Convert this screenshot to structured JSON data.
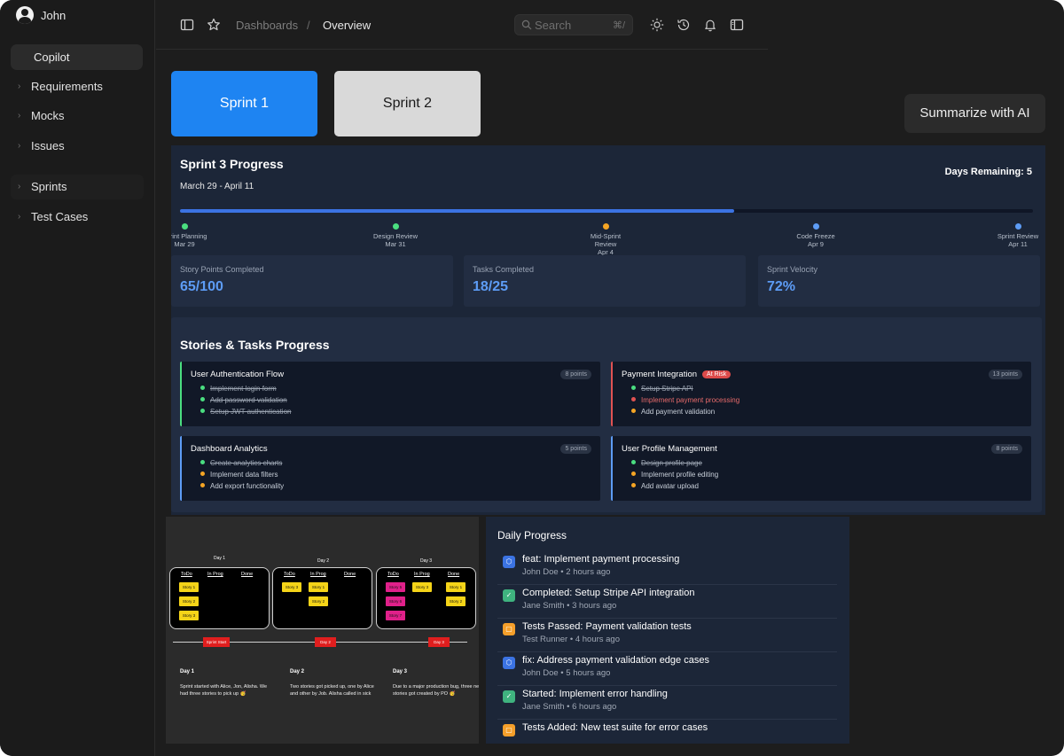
{
  "user": {
    "name": "John"
  },
  "sidebar": {
    "copilot_label": "Copilot",
    "items": [
      {
        "label": "Requirements"
      },
      {
        "label": "Mocks"
      },
      {
        "label": "Issues"
      },
      {
        "label": "Sprints"
      },
      {
        "label": "Test Cases"
      }
    ]
  },
  "topbar": {
    "breadcrumb_parent": "Dashboards",
    "breadcrumb_separator": "/",
    "breadcrumb_current": "Overview",
    "search_placeholder": "Search",
    "search_shortcut": "⌘/",
    "icons": [
      "sidebar-toggle-icon",
      "star-icon",
      "sun-icon",
      "history-icon",
      "bell-icon",
      "panel-icon"
    ]
  },
  "sprint_tabs": {
    "sprint1": "Sprint 1",
    "sprint2": "Sprint 2"
  },
  "summarize_label": "Summarize with AI",
  "progress": {
    "title": "Sprint 3 Progress",
    "dates": "March 29 - April 11",
    "days_remaining": "Days Remaining: 5",
    "fill_fraction": 0.65,
    "milestones": [
      {
        "name": "Sprint Planning",
        "date": "Mar 29",
        "color": "#4ade80"
      },
      {
        "name": "Design Review",
        "date": "Mar 31",
        "color": "#4ade80"
      },
      {
        "name": "Mid-Sprint Review",
        "date": "Apr 4",
        "color": "#f5a524"
      },
      {
        "name": "Code Freeze",
        "date": "Apr 9",
        "color": "#5d9cf5"
      },
      {
        "name": "Sprint Review",
        "date": "Apr 11",
        "color": "#5d9cf5"
      }
    ],
    "stats": [
      {
        "label": "Story Points Completed",
        "value": "65/100"
      },
      {
        "label": "Tasks Completed",
        "value": "18/25"
      },
      {
        "label": "Sprint Velocity",
        "value": "72%"
      }
    ]
  },
  "stories": {
    "title": "Stories & Tasks Progress",
    "cards": [
      {
        "title": "User Authentication Flow",
        "points": "8 points",
        "badge": "",
        "accent": "#4ade80",
        "tasks": [
          {
            "text": "Implement login form",
            "state": "done"
          },
          {
            "text": "Add password validation",
            "state": "done"
          },
          {
            "text": "Setup JWT authentication",
            "state": "done"
          }
        ]
      },
      {
        "title": "Payment Integration",
        "points": "13 points",
        "badge": "At Risk",
        "accent": "#e05252",
        "tasks": [
          {
            "text": "Setup Stripe API",
            "state": "done"
          },
          {
            "text": "Implement payment processing",
            "state": "late"
          },
          {
            "text": "Add payment validation",
            "state": "pending"
          }
        ]
      },
      {
        "title": "Dashboard Analytics",
        "points": "5 points",
        "badge": "",
        "accent": "#5d9cf5",
        "tasks": [
          {
            "text": "Create analytics charts",
            "state": "done"
          },
          {
            "text": "Implement data filters",
            "state": "pending"
          },
          {
            "text": "Add export functionality",
            "state": "pending"
          }
        ]
      },
      {
        "title": "User Profile Management",
        "points": "8 points",
        "badge": "",
        "accent": "#5d9cf5",
        "tasks": [
          {
            "text": "Design profile page",
            "state": "done"
          },
          {
            "text": "Implement profile editing",
            "state": "pending"
          },
          {
            "text": "Add avatar upload",
            "state": "pending"
          }
        ]
      }
    ]
  },
  "board": {
    "days": [
      {
        "label": "Day 1",
        "headers": [
          "ToDo",
          "In Prog",
          "Done"
        ],
        "todo": [
          {
            "t": "Story 1",
            "c": "#f5d418"
          },
          {
            "t": "Story 2",
            "c": "#f5d418"
          },
          {
            "t": "Story 3",
            "c": "#f5d418"
          }
        ],
        "inprog": [],
        "done": []
      },
      {
        "label": "Day 2",
        "headers": [
          "ToDo",
          "In Prog",
          "Done"
        ],
        "todo": [
          {
            "t": "Story 3",
            "c": "#f5d418"
          }
        ],
        "inprog": [
          {
            "t": "Story 1",
            "c": "#f5d418"
          },
          {
            "t": "Story 2",
            "c": "#f5d418"
          }
        ],
        "done": []
      },
      {
        "label": "Day 3",
        "headers": [
          "ToDo",
          "In Prog",
          "Done"
        ],
        "todo": [
          {
            "t": "Story 5",
            "c": "#e0208a"
          },
          {
            "t": "Story 6",
            "c": "#e0208a"
          },
          {
            "t": "Story 7",
            "c": "#e0208a"
          }
        ],
        "inprog": [
          {
            "t": "Story 3",
            "c": "#f5d418"
          }
        ],
        "done": [
          {
            "t": "Story 1",
            "c": "#f5d418"
          },
          {
            "t": "Story 2",
            "c": "#f5d418"
          }
        ]
      }
    ],
    "timeline": [
      "Sprint Start",
      "Day 2",
      "Day 3"
    ],
    "notes": [
      {
        "heading": "Day 1",
        "text": "Sprint started with Alice, Jon, Alisha. We had three stories to pick up 🥳"
      },
      {
        "heading": "Day 2",
        "text": "Two stories got picked up, one by Alice and other by Job. Alisha called in sick"
      },
      {
        "heading": "Day 3",
        "text": "Due to a major production bug, three new stories got created by PO 🥳"
      }
    ]
  },
  "daily": {
    "title": "Daily Progress",
    "events": [
      {
        "title": "feat: Implement payment processing",
        "meta": "John Doe • 2 hours ago",
        "kind": "commit",
        "color": "#3b73e3"
      },
      {
        "title": "Completed: Setup Stripe API integration",
        "meta": "Jane Smith • 3 hours ago",
        "kind": "check",
        "color": "#3fb37f"
      },
      {
        "title": "Tests Passed: Payment validation tests",
        "meta": "Test Runner • 4 hours ago",
        "kind": "test",
        "color": "#f59f2a"
      },
      {
        "title": "fix: Address payment validation edge cases",
        "meta": "John Doe • 5 hours ago",
        "kind": "commit",
        "color": "#3b73e3"
      },
      {
        "title": "Started: Implement error handling",
        "meta": "Jane Smith • 6 hours ago",
        "kind": "check",
        "color": "#3fb37f"
      },
      {
        "title": "Tests Added: New test suite for error cases",
        "meta": "",
        "kind": "test",
        "color": "#f59f2a"
      }
    ]
  }
}
